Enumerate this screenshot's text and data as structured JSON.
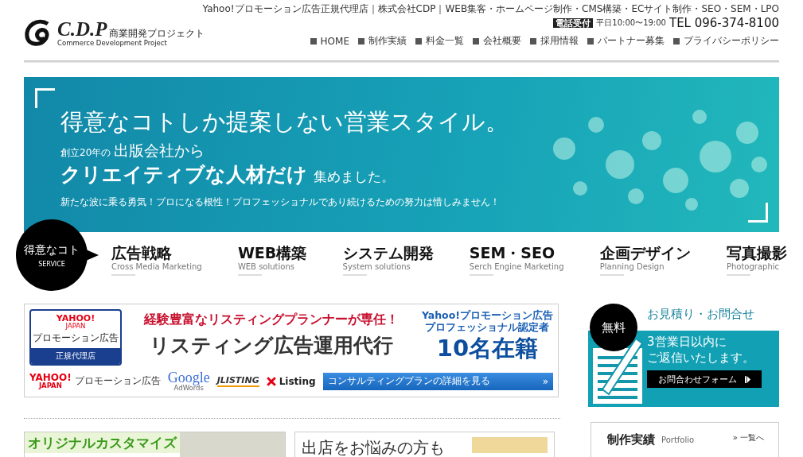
{
  "header": {
    "logo": {
      "mark": "C.D.P",
      "jp": "商業開発プロジェクト",
      "en": "Commerce Development Project"
    },
    "tagline": "Yahoo!プロモーション広告正規代理店｜株式会社CDP｜WEB集客・ホームページ制作・CMS構築・ECサイト制作・SEO・SEM・LPO",
    "phone_badge": "電話受付",
    "hours": "平日10:00〜19:00",
    "tel": "TEL 096-374-8100",
    "nav": [
      {
        "label": "HOME"
      },
      {
        "label": "制作実績"
      },
      {
        "label": "料金一覧"
      },
      {
        "label": "会社概要"
      },
      {
        "label": "採用情報"
      },
      {
        "label": "パートナー募集"
      },
      {
        "label": "プライバシーポリシー"
      }
    ]
  },
  "hero": {
    "headline": "得意なコトしか提案しない営業スタイル。",
    "line1_small": "創立20年の",
    "line1_big": "出版会社から",
    "line2_big": "クリエイティブな人材だけ",
    "line2_small": "集めました。",
    "description": "新たな波に乗る勇気！プロになる根性！プロフェッショナルであり続けるための努力は惜しみません！"
  },
  "services": {
    "badge_title": "得意なコト",
    "badge_sub": "SERVICE",
    "items": [
      {
        "title": "広告戦略",
        "subtitle": "Cross Media Marketing"
      },
      {
        "title": "WEB構築",
        "subtitle": "WEB solutions"
      },
      {
        "title": "システム開発",
        "subtitle": "System solutions"
      },
      {
        "title": "SEM・SEO",
        "subtitle": "Serch Engine Marketing"
      },
      {
        "title": "企画デザイン",
        "subtitle": "Planning Design"
      },
      {
        "title": "写真撮影",
        "subtitle": "Photographic"
      }
    ]
  },
  "listing_banner": {
    "agency_logo": "YAHOO!",
    "agency_logo_sub": "JAPAN",
    "agency_label": "プロモーション広告",
    "agency_badge": "正規代理店",
    "catch": "経験豊富なリスティングプランナーが専任！",
    "title": "リスティング広告運用代行",
    "cert_line1": "Yahoo!プロモーション広告",
    "cert_line2": "プロフェッショナル認定者",
    "cert_count": "10名在籍",
    "partners": [
      {
        "kind": "yahoo",
        "name": "YAHOO!",
        "sub": "JAPAN",
        "label": "プロモーション広告"
      },
      {
        "kind": "google",
        "name": "Google",
        "sub": "AdWords"
      },
      {
        "kind": "jlisting",
        "name": "JLISTING"
      },
      {
        "kind": "listing",
        "name": "Listing"
      }
    ],
    "button": "コンサルティングプランの詳細を見る",
    "button_icon": "»"
  },
  "contact": {
    "badge": "無料",
    "title": "お見積り・お問合せ",
    "message_line1": "3営業日以内に",
    "message_line2": "ご返信いたします。",
    "button": "お問合わせフォーム"
  },
  "bottom": {
    "custom_banner": "オリジナルカスタマイズ",
    "shop_banner": "出店をお悩みの方も",
    "portfolio": {
      "title": "制作実績",
      "subtitle": "Portfolio",
      "link_icon": "»",
      "link": "一覧へ"
    }
  }
}
